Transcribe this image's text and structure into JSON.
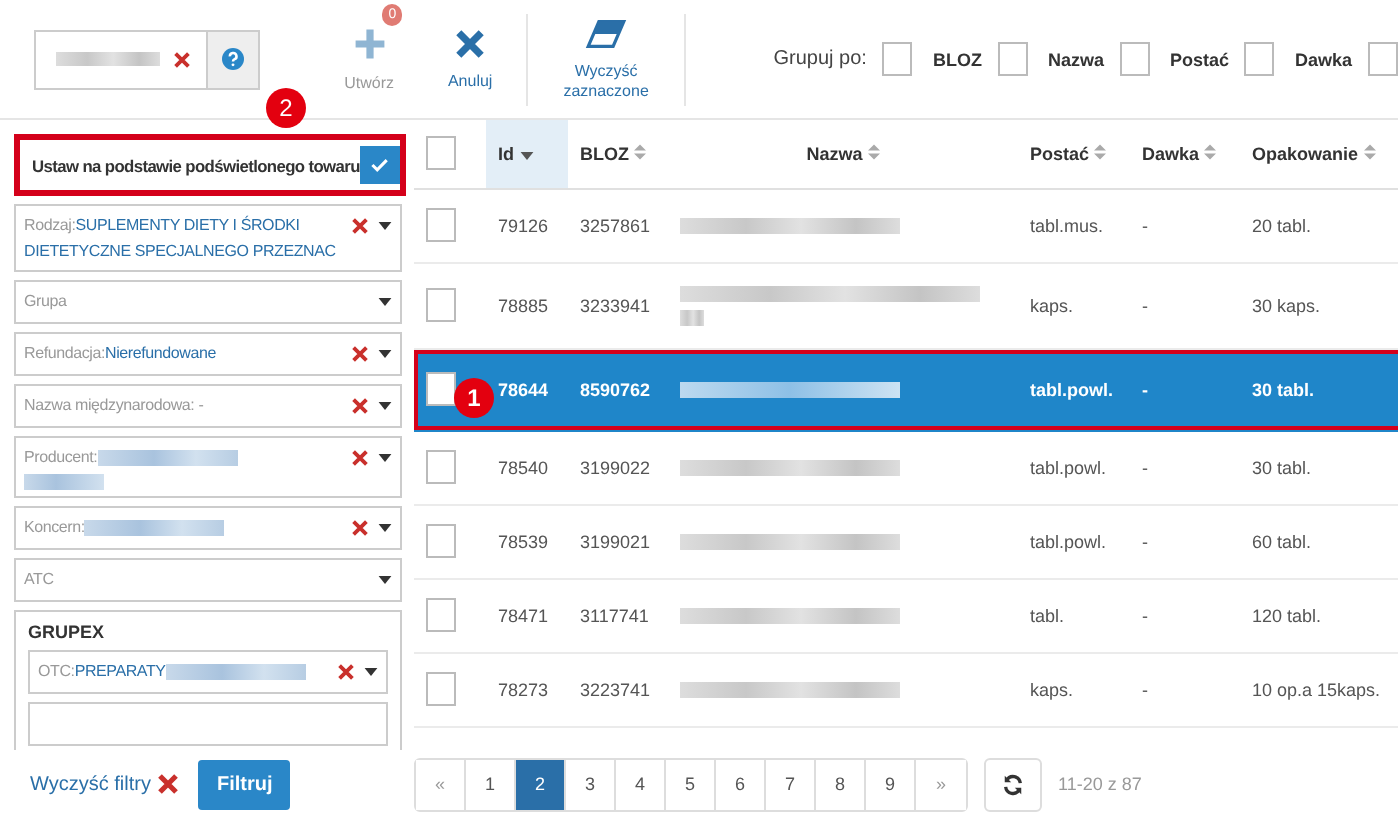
{
  "toolbar": {
    "search": {
      "redacted": true
    },
    "buttons": [
      {
        "label": "Utwórz",
        "kind": "create",
        "disabled": true,
        "badge": "0"
      },
      {
        "label": "Anuluj",
        "kind": "cancel",
        "disabled": false
      },
      {
        "label": "Wyczyść zaznaczone",
        "kind": "erase",
        "disabled": false
      }
    ],
    "group_by": {
      "label": "Grupuj po:",
      "options": [
        {
          "label": "BLOZ",
          "checked": false
        },
        {
          "label": "Nazwa",
          "checked": false
        },
        {
          "label": "Postać",
          "checked": false
        },
        {
          "label": "Dawka",
          "checked": false
        },
        {
          "checked": false
        }
      ]
    }
  },
  "filters": {
    "highlight_option": {
      "label": "Ustaw na podstawie podświetlonego towaru",
      "checked": true
    },
    "fields": [
      {
        "label": "Rodzaj:",
        "value": "SUPLEMENTY DIETY I ŚRODKI DIETETYCZNE SPECJALNEGO PRZEZNAC",
        "clearable": true
      },
      {
        "label": "Grupa",
        "clearable": false
      },
      {
        "label": "Refundacja:",
        "value": "Nierefundowane",
        "clearable": true
      },
      {
        "label": "Nazwa międzynarodowa: -",
        "clearable": true
      },
      {
        "label": "Producent:",
        "redacted": true,
        "wrapped": true,
        "clearable": true
      },
      {
        "label": "Koncern:",
        "redacted": true,
        "clearable": true
      },
      {
        "label": "ATC",
        "clearable": false
      }
    ],
    "section": {
      "title": "GRUPEX",
      "fields": [
        {
          "label": "OTC:",
          "value": "PREPARATY",
          "redacted": true,
          "clearable": true
        }
      ]
    },
    "clear_label": "Wyczyść filtry",
    "submit": "Filtruj"
  },
  "table": {
    "select_all": {
      "checked": false
    },
    "columns": [
      {
        "label": "Id",
        "sorted": true
      },
      {
        "label": "BLOZ",
        "sorted": false
      },
      {
        "label": "Nazwa",
        "sorted": false
      },
      {
        "label": "Postać",
        "sorted": false
      },
      {
        "label": "Dawka",
        "sorted": false
      },
      {
        "label": "Opakowanie",
        "sorted": false
      }
    ],
    "rows": [
      {
        "id": "79126",
        "bloz": "3257861",
        "postac": "tabl.mus.",
        "dawka": "-",
        "opakowanie": "20 tabl.",
        "checked": false,
        "selected": false,
        "wrapped": false
      },
      {
        "id": "78885",
        "bloz": "3233941",
        "postac": "kaps.",
        "dawka": "-",
        "opakowanie": "30 kaps.",
        "checked": false,
        "selected": false,
        "wrapped": true
      },
      {
        "id": "78644",
        "bloz": "8590762",
        "postac": "tabl.powl.",
        "dawka": "-",
        "opakowanie": "30 tabl.",
        "checked": false,
        "selected": true,
        "wrapped": false
      },
      {
        "id": "78540",
        "bloz": "3199022",
        "postac": "tabl.powl.",
        "dawka": "-",
        "opakowanie": "30 tabl.",
        "checked": false,
        "selected": false,
        "wrapped": false
      },
      {
        "id": "78539",
        "bloz": "3199021",
        "postac": "tabl.powl.",
        "dawka": "-",
        "opakowanie": "60 tabl.",
        "checked": false,
        "selected": false,
        "wrapped": false
      },
      {
        "id": "78471",
        "bloz": "3117741",
        "postac": "tabl.",
        "dawka": "-",
        "opakowanie": "120 tabl.",
        "checked": false,
        "selected": false,
        "wrapped": false
      },
      {
        "id": "78273",
        "bloz": "3223741",
        "postac": "kaps.",
        "dawka": "-",
        "opakowanie": "10 op.a 15kaps.",
        "checked": false,
        "selected": false,
        "wrapped": false
      }
    ]
  },
  "pagination": {
    "prev": "«",
    "next": "»",
    "pages": [
      {
        "label": "1",
        "selected": false
      },
      {
        "label": "2",
        "selected": true
      },
      {
        "label": "3",
        "selected": false
      },
      {
        "label": "4",
        "selected": false
      },
      {
        "label": "5",
        "selected": false
      },
      {
        "label": "6",
        "selected": false
      },
      {
        "label": "7",
        "selected": false
      },
      {
        "label": "8",
        "selected": false
      },
      {
        "label": "9",
        "selected": false
      }
    ],
    "range": "11-20 z 87"
  },
  "annotations": [
    {
      "label": "1",
      "kind": "row"
    },
    {
      "label": "2",
      "kind": "option"
    }
  ]
}
